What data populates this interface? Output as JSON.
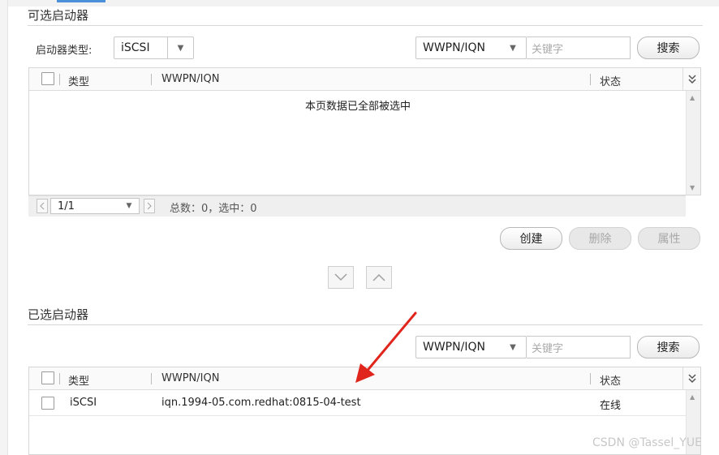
{
  "available": {
    "title": "可选启动器",
    "initiator_type_label": "启动器类型:",
    "initiator_type_value": "iSCSI",
    "filter_field": "WWPN/IQN",
    "keyword_placeholder": "关键字",
    "search_label": "搜索",
    "columns": {
      "type": "类型",
      "wwpn": "WWPN/IQN",
      "status": "状态"
    },
    "empty_message": "本页数据已全部被选中",
    "pager": {
      "page": "1/1",
      "summary": "总数：0，选中：0"
    },
    "actions": {
      "create": "创建",
      "delete": "删除",
      "properties": "属性"
    }
  },
  "selected": {
    "title": "已选启动器",
    "filter_field": "WWPN/IQN",
    "keyword_placeholder": "关键字",
    "search_label": "搜索",
    "columns": {
      "type": "类型",
      "wwpn": "WWPN/IQN",
      "status": "状态"
    },
    "rows": [
      {
        "type": "iSCSI",
        "wwpn": "iqn.1994-05.com.redhat:0815-04-test",
        "status": "在线"
      }
    ]
  },
  "icons": {
    "caret": "caret-down-icon",
    "double_chevron": "double-chevron-down-icon",
    "move_down": "chevron-down-icon",
    "move_up": "chevron-up-icon",
    "annotation": "red-arrow-icon"
  },
  "colors": {
    "arrow": "#e0261c"
  },
  "watermark": "CSDN @Tassel_YUE"
}
